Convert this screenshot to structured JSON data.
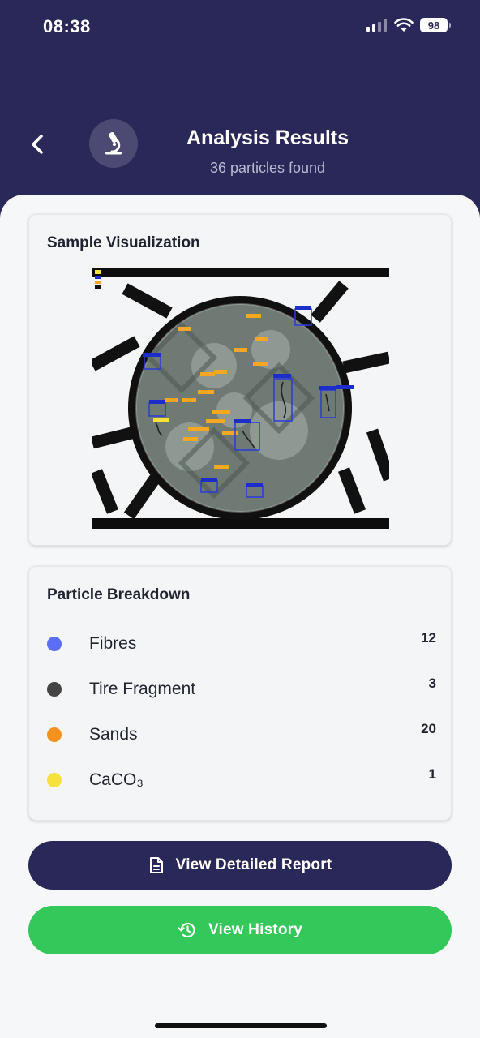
{
  "status_bar": {
    "time": "08:38",
    "battery": "98",
    "icons": [
      "signal-icon",
      "wifi-icon",
      "battery-icon"
    ]
  },
  "header": {
    "back_icon": "chevron-left-icon",
    "logo_icon": "microscope-icon",
    "title": "Analysis Results",
    "subtitle": "36 particles found"
  },
  "visualization": {
    "title": "Sample Visualization"
  },
  "breakdown": {
    "title": "Particle Breakdown",
    "items": [
      {
        "label": "Fibres",
        "count": "12",
        "color": "#5b6ef5"
      },
      {
        "label": "Tire Fragment",
        "count": "3",
        "color": "#444444"
      },
      {
        "label": "Sands",
        "count": "20",
        "color": "#f5921e"
      },
      {
        "label": "CaCO₃",
        "count": "1",
        "color": "#f7e13c"
      }
    ]
  },
  "actions": {
    "report_label": "View Detailed Report",
    "report_icon": "document-icon",
    "history_label": "View History",
    "history_icon": "history-icon"
  },
  "colors": {
    "header_bg": "#2a2858",
    "primary": "#2a2858",
    "success": "#34c759"
  }
}
